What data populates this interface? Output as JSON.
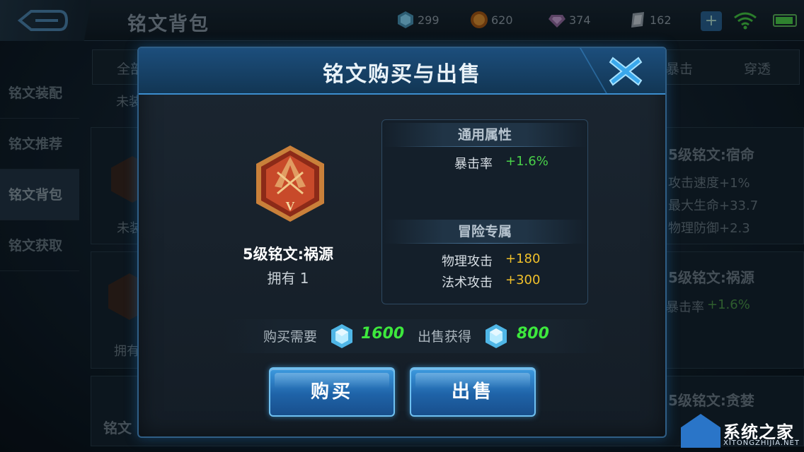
{
  "header": {
    "page_title": "铭文背包",
    "resources": [
      {
        "name": "diamond",
        "value": "299"
      },
      {
        "name": "gold-coin",
        "value": "620"
      },
      {
        "name": "gem",
        "value": "374"
      },
      {
        "name": "fragment",
        "value": "162"
      }
    ]
  },
  "sidebar": {
    "items": [
      {
        "label": "铭文装配"
      },
      {
        "label": "铭文推荐"
      },
      {
        "label": "铭文背包"
      },
      {
        "label": "铭文获取"
      }
    ]
  },
  "background": {
    "filters": [
      "全部",
      "暴击",
      "穿透"
    ],
    "partial_text": [
      "未装",
      "未装",
      "拥有",
      "铭文"
    ],
    "card1": {
      "title": "5级铭文:宿命",
      "attrs": [
        "攻击速度+1%",
        "最大生命+33.7",
        "物理防御+2.3"
      ]
    },
    "card2": {
      "title": "5级铭文:祸源",
      "attr_name": "暴击率",
      "attr_value": "+1.6%"
    },
    "card3": {
      "title": "5级铭文:贪婪"
    }
  },
  "modal": {
    "title": "铭文购买与出售",
    "rune_name": "5级铭文:祸源",
    "owned": "拥有 1",
    "emblem_level": "V",
    "general_section": "通用属性",
    "general_attrs": [
      {
        "name": "暴击率",
        "value": "+1.6%"
      }
    ],
    "adventure_section": "冒险专属",
    "adventure_attrs": [
      {
        "name": "物理攻击",
        "value": "+180"
      },
      {
        "name": "法术攻击",
        "value": "+300"
      }
    ],
    "buy_label": "购买需要",
    "buy_price": "1600",
    "sell_label": "出售获得",
    "sell_price": "800",
    "buy_button": "购买",
    "sell_button": "出售"
  },
  "watermark": {
    "text": "系统之家",
    "sub": "XITONGZHIJIA.NET"
  },
  "colors": {
    "accent": "#2f8fdc",
    "positive": "#49d149",
    "gold": "#f0c02a"
  }
}
